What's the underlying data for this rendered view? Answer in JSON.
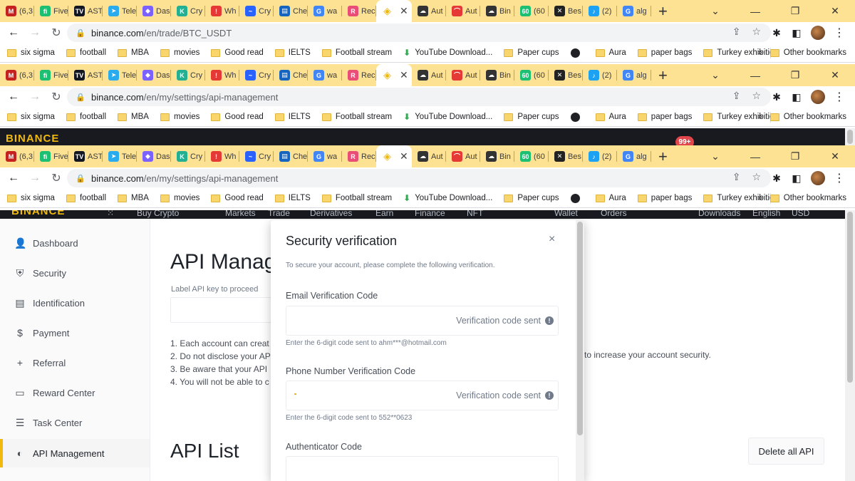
{
  "tabs": [
    {
      "label": "(6,3",
      "icon": "gmail-icon",
      "color": "#c5221f",
      "glyph": "M"
    },
    {
      "label": "Five",
      "icon": "fiverr-icon",
      "color": "#1dbf73",
      "glyph": "fi"
    },
    {
      "label": "AST",
      "icon": "tradingview-icon",
      "color": "#131722",
      "glyph": "TV"
    },
    {
      "label": "Tele",
      "icon": "telegram-icon",
      "color": "#2aabee",
      "glyph": "➤"
    },
    {
      "label": "Das",
      "icon": "dashboard-icon",
      "color": "#7b61ff",
      "glyph": "◆"
    },
    {
      "label": "Cry",
      "icon": "kucoin-icon",
      "color": "#23af91",
      "glyph": "K"
    },
    {
      "label": "Wh",
      "icon": "alert-icon",
      "color": "#e53935",
      "glyph": "!"
    },
    {
      "label": "Cry",
      "icon": "crypto-icon",
      "color": "#2962ff",
      "glyph": "~"
    },
    {
      "label": "Che",
      "icon": "chart-icon",
      "color": "#1565c0",
      "glyph": "▤"
    },
    {
      "label": "wa",
      "icon": "google-icon",
      "color": "#4285f4",
      "glyph": "G"
    },
    {
      "label": "Rec",
      "icon": "rec-icon",
      "color": "#e94e77",
      "glyph": "R"
    }
  ],
  "tabs_right": [
    {
      "label": "Aut",
      "icon": "cloud-icon",
      "color": "#333333",
      "glyph": "☁"
    },
    {
      "label": "Aut",
      "icon": "rainbow-icon",
      "color": "#e53935",
      "glyph": "⌒"
    },
    {
      "label": "Bin",
      "icon": "cloud-icon",
      "color": "#333333",
      "glyph": "☁"
    },
    {
      "label": "(60",
      "icon": "number-icon",
      "color": "#1dbf73",
      "glyph": "60"
    },
    {
      "label": "Bes",
      "icon": "x-icon",
      "color": "#222222",
      "glyph": "✕"
    },
    {
      "label": "(2)",
      "icon": "twitter-icon",
      "color": "#1da1f2",
      "glyph": "♪"
    },
    {
      "label": "alg",
      "icon": "google-icon",
      "color": "#4285f4",
      "glyph": "G"
    }
  ],
  "active_tab": {
    "icon": "binance-icon",
    "color": "#f0b90b"
  },
  "url_top": {
    "domain": "binance.com",
    "path": "/en/trade/BTC_USDT"
  },
  "url_main": {
    "domain": "binance.com",
    "path": "/en/my/settings/api-management"
  },
  "bookmarks": [
    "six sigma",
    "football",
    "MBA",
    "movies",
    "Good read",
    "IELTS",
    "Football stream",
    "YouTube Download...",
    "Paper cups",
    "",
    "Aura",
    "paper bags",
    "Turkey exhibition"
  ],
  "bookmarks_more": "»",
  "other_bookmarks": "Other bookmarks",
  "notification_badge": "99+",
  "brand": "BINANCE",
  "topnav": [
    "Buy Crypto",
    "Markets",
    "Trade",
    "Derivatives",
    "Earn",
    "Finance",
    "NFT",
    "Wallet",
    "Orders",
    "Downloads",
    "English",
    "USD"
  ],
  "sidebar": [
    {
      "label": "Dashboard",
      "icon": "person-icon",
      "glyph": "👤"
    },
    {
      "label": "Security",
      "icon": "shield-icon",
      "glyph": "⛨"
    },
    {
      "label": "Identification",
      "icon": "id-card-icon",
      "glyph": "▤"
    },
    {
      "label": "Payment",
      "icon": "dollar-icon",
      "glyph": "$"
    },
    {
      "label": "Referral",
      "icon": "add-user-icon",
      "glyph": "+"
    },
    {
      "label": "Reward Center",
      "icon": "ticket-icon",
      "glyph": "▭"
    },
    {
      "label": "Task Center",
      "icon": "clipboard-icon",
      "glyph": "☰"
    },
    {
      "label": "API Management",
      "icon": "api-icon",
      "glyph": "◐"
    }
  ],
  "main": {
    "title": "API Manage",
    "label": "Label API key to proceed",
    "notes": [
      "1. Each account can creat",
      "2. Do not disclose your AP",
      "3. Be aware that your API",
      "4. You will not be able to c"
    ],
    "notes_tail": "to increase your account security.",
    "list_title": "API List",
    "delete_all": "Delete all API"
  },
  "modal": {
    "title": "Security verification",
    "close": "×",
    "subtitle": "To secure your account, please complete the following verification.",
    "email_label": "Email Verification Code",
    "email_status": "Verification code sent",
    "email_hint": "Enter the 6-digit code sent to ahm***@hotmail.com",
    "phone_label": "Phone Number Verification Code",
    "phone_status": "Verification code sent",
    "phone_hint": "Enter the 6-digit code sent to 552**0623",
    "auth_label": "Authenticator Code"
  }
}
